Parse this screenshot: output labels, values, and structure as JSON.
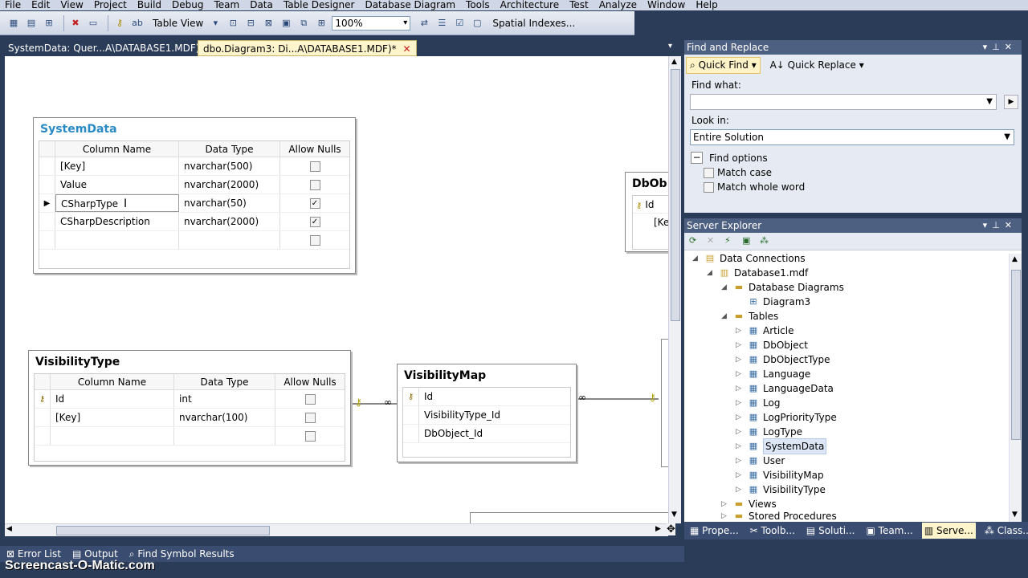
{
  "menu": [
    "File",
    "Edit",
    "View",
    "Project",
    "Build",
    "Debug",
    "Team",
    "Data",
    "Table Designer",
    "Database Diagram",
    "Tools",
    "Architecture",
    "Test",
    "Analyze",
    "Window",
    "Help"
  ],
  "toolbar": {
    "table_view": "Table View",
    "zoom": "100%",
    "spatial": "Spatial Indexes..."
  },
  "doc_tabs": [
    {
      "label": "SystemData: Quer...A\\DATABASE1.MDF)"
    },
    {
      "label": "dbo.Diagram3: Di...A\\DATABASE1.MDF)*",
      "close": "✕"
    }
  ],
  "tables": {
    "systemdata": {
      "title": "SystemData",
      "headers": [
        "Column Name",
        "Data Type",
        "Allow Nulls"
      ],
      "rows": [
        {
          "name": "[Key]",
          "type": "nvarchar(500)",
          "nulls": false
        },
        {
          "name": "Value",
          "type": "nvarchar(2000)",
          "nulls": false
        },
        {
          "name": "CSharpType",
          "type": "nvarchar(50)",
          "nulls": true
        },
        {
          "name": "CSharpDescription",
          "type": "nvarchar(2000)",
          "nulls": true
        },
        {
          "name": "",
          "type": "",
          "nulls": false
        }
      ]
    },
    "visibilitytype": {
      "title": "VisibilityType",
      "headers": [
        "Column Name",
        "Data Type",
        "Allow Nulls"
      ],
      "rows": [
        {
          "name": "Id",
          "type": "int",
          "nulls": false,
          "key": true
        },
        {
          "name": "[Key]",
          "type": "nvarchar(100)",
          "nulls": false
        },
        {
          "name": "",
          "type": "",
          "nulls": false
        }
      ]
    },
    "visibilitymap": {
      "title": "VisibilityMap",
      "rows": [
        "Id",
        "VisibilityType_Id",
        "DbObject_Id"
      ]
    },
    "dbobject": {
      "title": "DbOb",
      "rows": [
        "Id",
        "[Ke"
      ]
    }
  },
  "find": {
    "title": "Find and Replace",
    "quick_find": "Quick Find",
    "quick_replace": "Quick Replace",
    "find_what": "Find what:",
    "look_in": "Look in:",
    "look_in_value": "Entire Solution",
    "find_options": "Find options",
    "match_case": "Match case",
    "match_whole": "Match whole word"
  },
  "server": {
    "title": "Server Explorer",
    "nodes": [
      {
        "label": "Data Connections"
      },
      {
        "label": "Database1.mdf"
      },
      {
        "label": "Database Diagrams"
      },
      {
        "label": "Diagram3"
      },
      {
        "label": "Tables"
      },
      {
        "label": "Article"
      },
      {
        "label": "DbObject"
      },
      {
        "label": "DbObjectType"
      },
      {
        "label": "Language"
      },
      {
        "label": "LanguageData"
      },
      {
        "label": "Log"
      },
      {
        "label": "LogPriorityType"
      },
      {
        "label": "LogType"
      },
      {
        "label": "SystemData"
      },
      {
        "label": "User"
      },
      {
        "label": "VisibilityMap"
      },
      {
        "label": "VisibilityType"
      },
      {
        "label": "Views"
      },
      {
        "label": "Stored Procedures"
      }
    ]
  },
  "bottom_tabs": [
    "Prope...",
    "Toolb...",
    "Soluti...",
    "Team...",
    "Serve...",
    "Class..."
  ],
  "status_tabs": [
    "Error List",
    "Output",
    "Find Symbol Results"
  ],
  "watermark": "Screencast-O-Matic.com"
}
